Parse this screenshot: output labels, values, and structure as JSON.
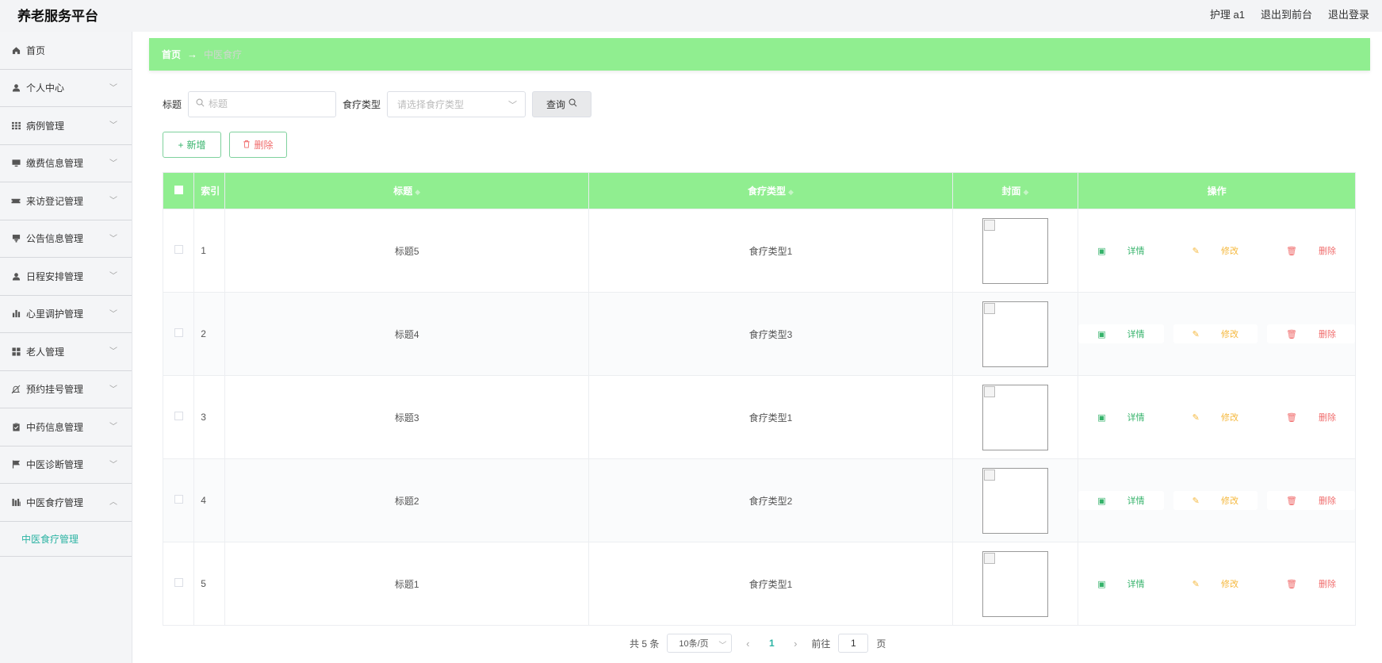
{
  "app": {
    "title": "养老服务平台"
  },
  "header": {
    "user": "护理 a1",
    "frontend": "退出到前台",
    "logout": "退出登录"
  },
  "sidebar": {
    "items": [
      {
        "label": "首页",
        "icon": "home-icon"
      },
      {
        "label": "个人中心",
        "icon": "user-icon"
      },
      {
        "label": "病例管理",
        "icon": "grid-icon"
      },
      {
        "label": "缴费信息管理",
        "icon": "monitor-icon"
      },
      {
        "label": "来访登记管理",
        "icon": "ticket-icon"
      },
      {
        "label": "公告信息管理",
        "icon": "notice-icon"
      },
      {
        "label": "日程安排管理",
        "icon": "user-icon"
      },
      {
        "label": "心里调护管理",
        "icon": "bar-chart-icon"
      },
      {
        "label": "老人管理",
        "icon": "apps-icon"
      },
      {
        "label": "预约挂号管理",
        "icon": "bell-off-icon"
      },
      {
        "label": "中药信息管理",
        "icon": "clipboard-icon"
      },
      {
        "label": "中医诊断管理",
        "icon": "flag-icon"
      },
      {
        "label": "中医食疗管理",
        "icon": "chart-icon"
      }
    ],
    "active_sub": "中医食疗管理"
  },
  "breadcrumb": {
    "home": "首页",
    "arrow": "→",
    "current": "中医食疗"
  },
  "search": {
    "title_label": "标题",
    "title_placeholder": "标题",
    "type_label": "食疗类型",
    "type_placeholder": "请选择食疗类型",
    "query_label": "查询"
  },
  "actions": {
    "add": "新增",
    "delete": "删除"
  },
  "table": {
    "headers": {
      "index": "索引",
      "title": "标题",
      "type": "食疗类型",
      "cover": "封面",
      "ops": "操作"
    },
    "rows": [
      {
        "index": "1",
        "title": "标题5",
        "type": "食疗类型1"
      },
      {
        "index": "2",
        "title": "标题4",
        "type": "食疗类型3"
      },
      {
        "index": "3",
        "title": "标题3",
        "type": "食疗类型1"
      },
      {
        "index": "4",
        "title": "标题2",
        "type": "食疗类型2"
      },
      {
        "index": "5",
        "title": "标题1",
        "type": "食疗类型1"
      }
    ],
    "ops": {
      "detail": "详情",
      "edit": "修改",
      "remove": "删除"
    }
  },
  "pager": {
    "total": "共 5 条",
    "size": "10条/页",
    "current": "1",
    "goto": "前往",
    "page_value": "1",
    "page_suffix": "页"
  },
  "colors": {
    "accent": "#90ee90",
    "active": "#2bb3a3",
    "edit": "#f5b83d",
    "danger": "#f06c6c"
  }
}
